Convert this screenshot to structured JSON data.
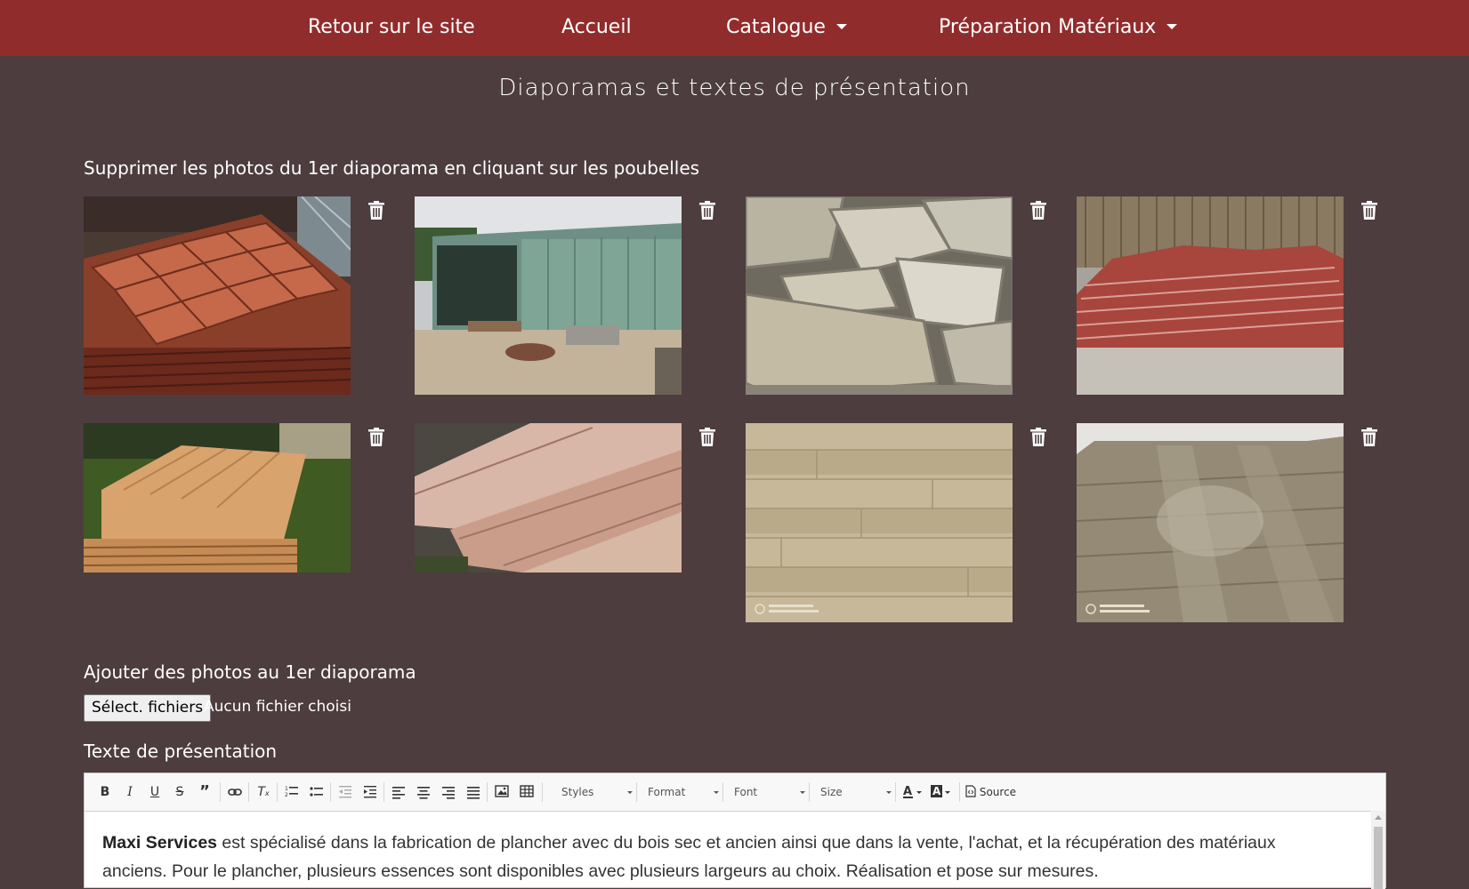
{
  "nav": {
    "items": [
      {
        "label": "Retour sur le site",
        "dropdown": false
      },
      {
        "label": "Accueil",
        "dropdown": false
      },
      {
        "label": "Catalogue",
        "dropdown": true
      },
      {
        "label": "Préparation Matériaux",
        "dropdown": true
      }
    ],
    "background": "#912c2c"
  },
  "page": {
    "title": "Diaporamas et textes de présentation",
    "background": "#4d3d3f"
  },
  "slideshow": {
    "delete_label": "Supprimer les photos du 1er diaporama en cliquant sur les poubelles",
    "photos": [
      {
        "subject": "terracotta floor tiles stacked on pallet"
      },
      {
        "subject": "green barn with stones in yard"
      },
      {
        "subject": "pile of stone slabs"
      },
      {
        "subject": "stacked red terracotta tiles in front of fence"
      },
      {
        "subject": "stacked wooden planks outdoors"
      },
      {
        "subject": "rough sawn wood boards"
      },
      {
        "subject": "light wood plank floor"
      },
      {
        "subject": "wooden floor in empty room"
      }
    ],
    "add_label": "Ajouter des photos au 1er diaporama",
    "file_button": "Sélect. fichiers",
    "file_status": "Aucun fichier choisi"
  },
  "editor": {
    "label": "Texte de présentation",
    "toolbar": {
      "styles": "Styles",
      "format": "Format",
      "font": "Font",
      "size": "Size",
      "source": "Source"
    },
    "content": {
      "bold": "Maxi Services",
      "line1": " est spécialisé dans la fabrication de plancher avec du bois sec et ancien ainsi que dans la vente, l'achat, et la récupération des matériaux",
      "line2": "anciens. Pour le plancher, plusieurs essences sont disponibles avec plusieurs largeurs au choix. Réalisation et pose sur mesures."
    }
  }
}
